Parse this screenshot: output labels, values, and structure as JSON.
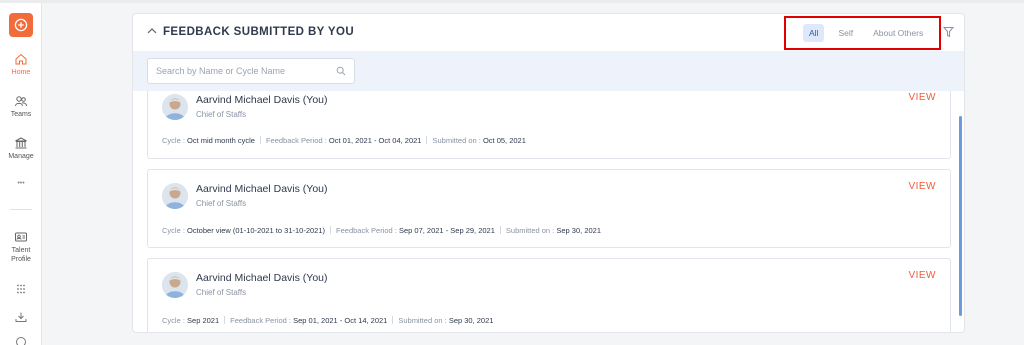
{
  "sidebar": {
    "items": [
      {
        "label": "Home",
        "icon": "home-icon",
        "active": true
      },
      {
        "label": "Teams",
        "icon": "teams-icon"
      },
      {
        "label": "Manage",
        "icon": "bank-icon"
      },
      {
        "label": "•••",
        "icon": "more-icon"
      },
      {
        "label": "Talent Profile",
        "icon": "id-card-icon"
      },
      {
        "label": "",
        "icon": "grid-icon"
      },
      {
        "label": "",
        "icon": "download-icon"
      },
      {
        "label": "",
        "icon": "badge-icon"
      }
    ]
  },
  "panel": {
    "title": "FEEDBACK SUBMITTED BY YOU",
    "filters": [
      "All",
      "Self",
      "About Others"
    ],
    "active_filter": "All",
    "search_placeholder": "Search by Name or Cycle Name"
  },
  "entries": [
    {
      "name": "Aarvind Michael Davis (You)",
      "role": "Chief of Staffs",
      "action": "VIEW",
      "cycle_label": "Cycle :",
      "cycle": "Oct mid month cycle",
      "period_label": "Feedback Period :",
      "period": "Oct 01, 2021 - Oct 04, 2021",
      "submitted_label": "Submitted on :",
      "submitted": "Oct 05, 2021"
    },
    {
      "name": "Aarvind Michael Davis (You)",
      "role": "Chief of Staffs",
      "action": "VIEW",
      "cycle_label": "Cycle :",
      "cycle": "October view (01-10-2021 to 31-10-2021)",
      "period_label": "Feedback Period :",
      "period": "Sep 07, 2021 - Sep 29, 2021",
      "submitted_label": "Submitted on :",
      "submitted": "Sep 30, 2021"
    },
    {
      "name": "Aarvind Michael Davis (You)",
      "role": "Chief of Staffs",
      "action": "VIEW",
      "cycle_label": "Cycle :",
      "cycle": "Sep 2021",
      "period_label": "Feedback Period :",
      "period": "Sep 01, 2021 - Oct 14, 2021",
      "submitted_label": "Submitted on :",
      "submitted": "Sep 30, 2021"
    }
  ],
  "colors": {
    "accent": "#f26b3a",
    "view": "#ef5b3a",
    "highlight_box": "#e00000",
    "active_pill": "#dde9fb"
  }
}
